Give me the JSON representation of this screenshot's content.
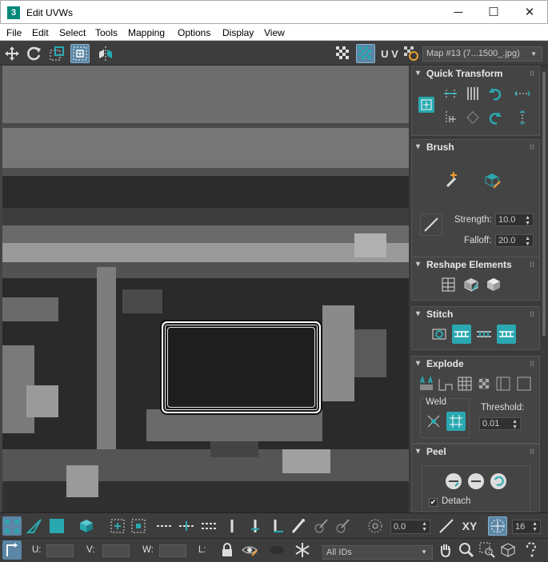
{
  "window": {
    "app_icon": "3",
    "title": "Edit UVWs",
    "minimize": "─",
    "maximize": "☐",
    "close": "✕"
  },
  "menu": [
    "File",
    "Edit",
    "Select",
    "Tools",
    "Mapping",
    "Options",
    "Display",
    "View"
  ],
  "toolbar": {
    "uv_label": "U V",
    "map_selector": "Map #13 (7...1500_.jpg)"
  },
  "panels": {
    "quick_transform": "Quick Transform",
    "brush": "Brush",
    "strength_label": "Strength:",
    "strength_value": "10.0",
    "falloff_label": "Falloff:",
    "falloff_value": "20.0",
    "reshape": "Reshape Elements",
    "stitch": "Stitch",
    "explode": "Explode",
    "weld": "Weld",
    "threshold_label": "Threshold:",
    "threshold_value": "0.01",
    "peel": "Peel",
    "detach": "Detach",
    "detach_checked": true
  },
  "bottom": {
    "rotation_value": "0.0",
    "xy_label": "XY",
    "grid_value": "16",
    "u_label": "U:",
    "v_label": "V:",
    "w_label": "W:",
    "l_label": "L:",
    "ids_filter": "All IDs"
  },
  "colors": {
    "accent": "#2aa8b0",
    "active_blue": "#5b86a6",
    "panel_bg": "#444444"
  }
}
